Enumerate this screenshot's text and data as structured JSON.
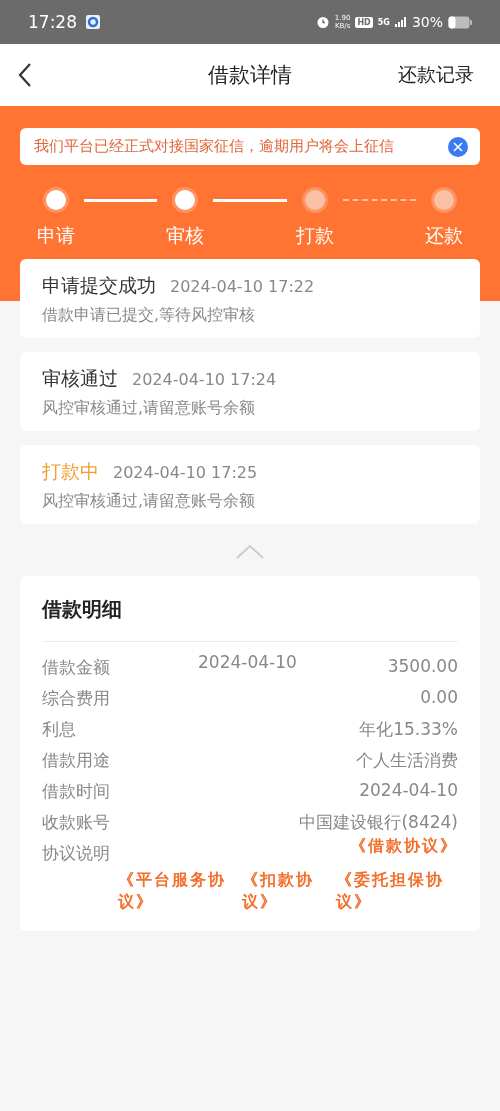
{
  "status_bar": {
    "time": "17:28",
    "speed_value": "1.90",
    "speed_unit": "KB/s",
    "hd": "HD",
    "network": "5G",
    "battery": "30%"
  },
  "nav": {
    "title": "借款详情",
    "action": "还款记录"
  },
  "notice": {
    "text": "我们平台已经正式对接国家征信，逾期用户将会上征信"
  },
  "steps": [
    {
      "label": "申请",
      "done": true
    },
    {
      "label": "审核",
      "done": true
    },
    {
      "label": "打款",
      "done": false
    },
    {
      "label": "还款",
      "done": false
    }
  ],
  "timeline": [
    {
      "title": "申请提交成功",
      "time": "2024-04-10 17:22",
      "desc": "借款申请已提交,等待风控审核",
      "kind": "done"
    },
    {
      "title": "审核通过",
      "time": "2024-04-10 17:24",
      "desc": "风控审核通过,请留意账号余额",
      "kind": "done"
    },
    {
      "title": "打款中",
      "time": "2024-04-10 17:25",
      "desc": "风控审核通过,请留意账号余额",
      "kind": "active"
    }
  ],
  "details": {
    "title": "借款明细",
    "rows": [
      {
        "label": "借款金额",
        "note": "2024-04-10",
        "value": "3500.00"
      },
      {
        "label": "综合费用",
        "value": "0.00"
      },
      {
        "label": "利息",
        "value": "年化15.33%"
      },
      {
        "label": "借款用途",
        "value": "个人生活消费"
      },
      {
        "label": "借款时间",
        "value": "2024-04-10"
      },
      {
        "label": "收款账号",
        "value": "中国建设银行(8424)"
      }
    ],
    "agreement_label": "协议说明",
    "agreements": [
      "《借款协议》",
      "《平台服务协议》",
      "《扣款协议》",
      "《委托担保协议》"
    ]
  }
}
